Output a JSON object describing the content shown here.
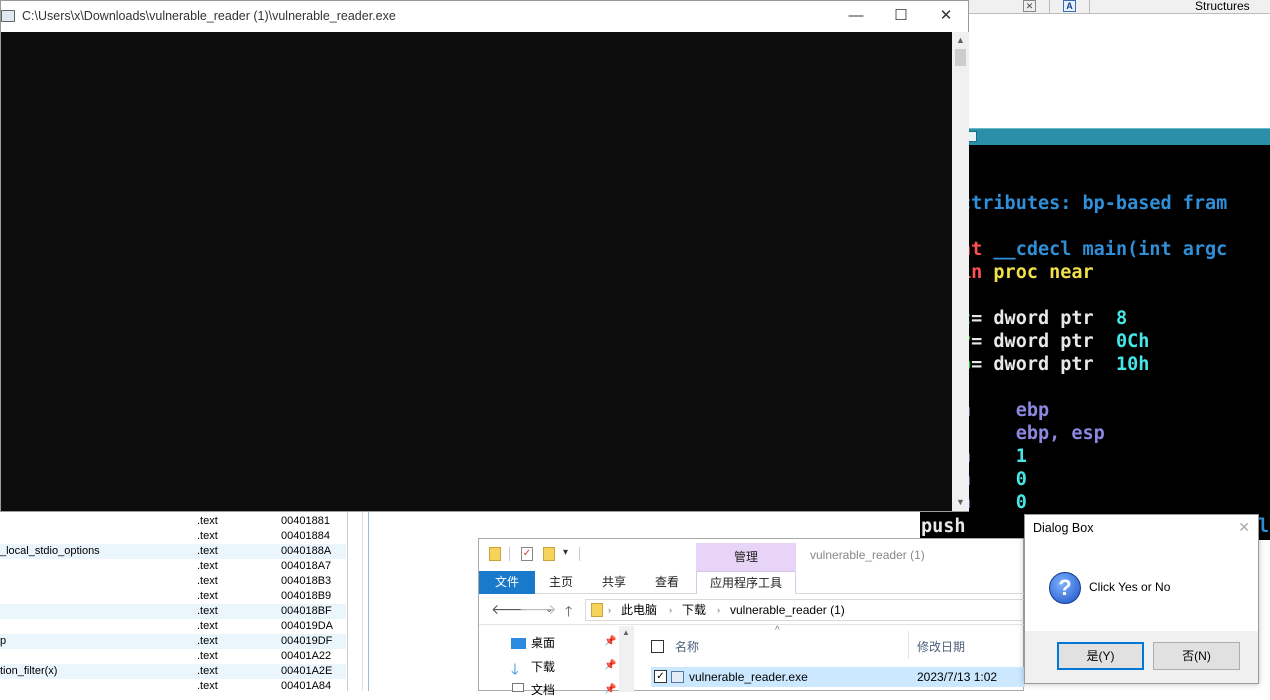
{
  "ida": {
    "structures_tab": "Structures",
    "code_lines": [
      {
        "segs": [
          {
            "t": "ctributes: bp-based fram",
            "c": "c-blue"
          }
        ]
      },
      {
        "segs": [
          {
            "t": "nt ",
            "c": "c-red"
          },
          {
            "t": "__cdecl main(int argc",
            "c": "c-blue"
          }
        ]
      },
      {
        "segs": [
          {
            "t": "in ",
            "c": "c-red"
          },
          {
            "t": "proc near",
            "c": "c-yellow"
          }
        ]
      },
      {
        "segs": [
          {
            "t": "c",
            "c": "c-green"
          },
          {
            "t": "= dword ptr  ",
            "c": "c-white"
          },
          {
            "t": "8",
            "c": "c-cyan"
          }
        ]
      },
      {
        "segs": [
          {
            "t": "v",
            "c": "c-green"
          },
          {
            "t": "= dword ptr  ",
            "c": "c-white"
          },
          {
            "t": "0Ch",
            "c": "c-cyan"
          }
        ]
      },
      {
        "segs": [
          {
            "t": "p",
            "c": "c-green"
          },
          {
            "t": "= dword ptr  ",
            "c": "c-white"
          },
          {
            "t": "10h",
            "c": "c-cyan"
          }
        ]
      },
      {
        "segs": [
          {
            "t": "h    ",
            "c": "c-purple"
          },
          {
            "t": "ebp",
            "c": "c-purple"
          }
        ]
      },
      {
        "segs": [
          {
            "t": "     ",
            "c": "c-white"
          },
          {
            "t": "ebp, esp",
            "c": "c-purple"
          }
        ]
      },
      {
        "segs": [
          {
            "t": "h    ",
            "c": "c-purple"
          },
          {
            "t": "1",
            "c": "c-cyan"
          }
        ]
      },
      {
        "segs": [
          {
            "t": "h    ",
            "c": "c-purple"
          },
          {
            "t": "0",
            "c": "c-cyan"
          }
        ]
      },
      {
        "segs": [
          {
            "t": "h    ",
            "c": "c-purple"
          },
          {
            "t": "0",
            "c": "c-cyan"
          }
        ]
      }
    ],
    "push_line": "push",
    "push_tail": "l"
  },
  "console": {
    "title": "C:\\Users\\x\\Downloads\\vulnerable_reader (1)\\vulnerable_reader.exe",
    "minimize_glyph": "—",
    "maximize_glyph": "☐",
    "close_glyph": "✕"
  },
  "functions": [
    {
      "name": "",
      "segment": ".text",
      "address": "00401881",
      "alt": false
    },
    {
      "name": "",
      "segment": ".text",
      "address": "00401884",
      "alt": false
    },
    {
      "name": "_local_stdio_options",
      "segment": ".text",
      "address": "0040188A",
      "alt": true
    },
    {
      "name": "",
      "segment": ".text",
      "address": "004018A7",
      "alt": false
    },
    {
      "name": "",
      "segment": ".text",
      "address": "004018B3",
      "alt": false
    },
    {
      "name": "",
      "segment": ".text",
      "address": "004018B9",
      "alt": false
    },
    {
      "name": "",
      "segment": ".text",
      "address": "004018BF",
      "alt": true
    },
    {
      "name": "",
      "segment": ".text",
      "address": "004019DA",
      "alt": false
    },
    {
      "name": "p",
      "segment": ".text",
      "address": "004019DF",
      "alt": true
    },
    {
      "name": "",
      "segment": ".text",
      "address": "00401A22",
      "alt": false
    },
    {
      "name": "tion_filter(x)",
      "segment": ".text",
      "address": "00401A2E",
      "alt": true
    },
    {
      "name": "",
      "segment": ".text",
      "address": "00401A84",
      "alt": false
    }
  ],
  "explorer": {
    "manage_label": "管理",
    "window_title": "vulnerable_reader (1)",
    "tabs": {
      "file": "文件",
      "home": "主页",
      "share": "共享",
      "view": "查看",
      "app_tools": "应用程序工具"
    },
    "breadcrumb": {
      "pc": "此电脑",
      "downloads": "下载",
      "folder": "vulnerable_reader (1)"
    },
    "nav": {
      "desktop": "桌面",
      "downloads": "下载",
      "documents": "文档"
    },
    "columns": {
      "name": "名称",
      "modified": "修改日期"
    },
    "file": {
      "name": "vulnerable_reader.exe",
      "modified": "2023/7/13 1:02"
    }
  },
  "dialog": {
    "title": "Dialog Box",
    "message": "Click Yes or No",
    "yes_label": "是(Y)",
    "no_label": "否(N)",
    "icon_glyph": "?"
  }
}
